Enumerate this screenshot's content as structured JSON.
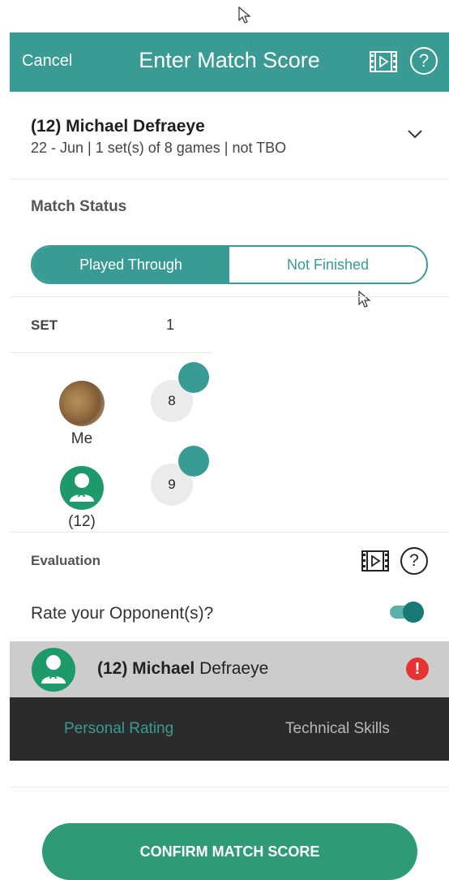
{
  "header": {
    "cancel_label": "Cancel",
    "title": "Enter Match Score",
    "film_icon": "film-icon",
    "help_icon": "help-icon",
    "help_glyph": "?"
  },
  "match": {
    "name": "(12) Michael Defraeye",
    "details": "22 - Jun | 1 set(s) of 8 games | not TBO"
  },
  "match_status": {
    "label": "Match Status",
    "options": [
      "Played Through",
      "Not Finished"
    ],
    "selected": "Played Through"
  },
  "score": {
    "set_header": "SET",
    "sets": [
      "1"
    ],
    "players": [
      {
        "label": "Me",
        "score": "8"
      },
      {
        "label": "(12)",
        "score": "9"
      }
    ]
  },
  "evaluation": {
    "label": "Evaluation",
    "help_glyph": "?",
    "rate_label": "Rate your Opponent(s)?",
    "rate_enabled": true,
    "opponent": {
      "prefix": "(12) Michael",
      "suffix": "Defraeye"
    },
    "alert_glyph": "!",
    "tabs": [
      "Personal Rating",
      "Technical Skills"
    ],
    "active_tab": "Personal Rating"
  },
  "confirm_label": "CONFIRM MATCH SCORE",
  "colors": {
    "primary": "#3a9a94",
    "confirm": "#2f9a76",
    "alert": "#e53333",
    "tab_bar": "#2b2b2b"
  }
}
